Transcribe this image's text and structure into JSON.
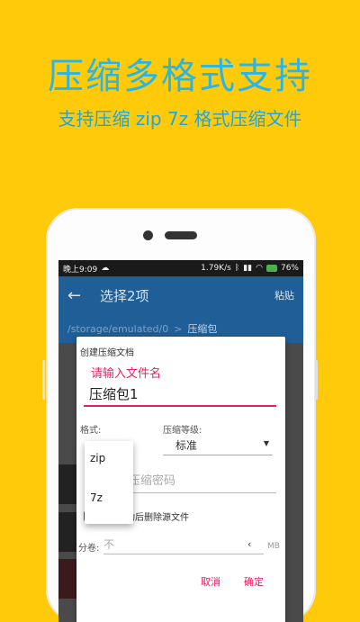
{
  "promo": {
    "headline": "压缩多格式支持",
    "subhead": "支持压缩 zip 7z 格式压缩文件"
  },
  "statusbar": {
    "time": "晚上9:09",
    "network_speed": "1.79K/s",
    "battery": "76%"
  },
  "appbar": {
    "back_icon": "arrow-back-icon",
    "title": "选择2项",
    "action": "粘贴"
  },
  "pathbar": {
    "path": "/storage/emulated/0",
    "separator": ">",
    "current": "压缩包"
  },
  "dialog": {
    "title": "创建压缩文档",
    "name_label": "请输入文件名",
    "name_value": "压缩包1",
    "format_label": "格式:",
    "level_label": "压缩等级:",
    "level_value": "标准",
    "password_placeholder": "压缩密码",
    "delete_source_label": "压缩成功后删除源文件",
    "split_label": "分卷:",
    "split_value": "不",
    "split_unit": "MB",
    "cancel": "取消",
    "confirm": "确定"
  },
  "format_popup": {
    "options": [
      "zip",
      "7z"
    ]
  },
  "colors": {
    "background": "#FFCA0A",
    "headline": "#29B6E6",
    "appbar": "#1F5E96",
    "accent": "#E91E63"
  }
}
